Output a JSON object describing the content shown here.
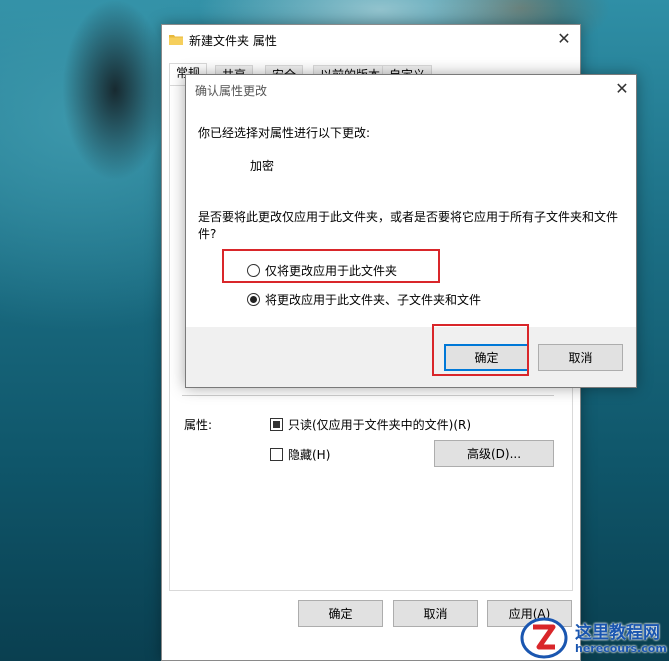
{
  "props_window": {
    "title": "新建文件夹 属性",
    "tabs": [
      {
        "label": "常规"
      },
      {
        "label": "共享"
      },
      {
        "label": "安全"
      },
      {
        "label": "以前的版本"
      },
      {
        "label": "自定义"
      }
    ],
    "attributes_label": "属性:",
    "readonly_label": "只读(仅应用于文件夹中的文件)(R)",
    "hidden_label": "隐藏(H)",
    "advanced_button": "高级(D)...",
    "ok_button": "确定",
    "cancel_button": "取消",
    "apply_button": "应用(A)"
  },
  "dialog": {
    "title": "确认属性更改",
    "intro": "你已经选择对属性进行以下更改:",
    "change": "加密",
    "question_line1": "是否要将此更改仅应用于此文件夹，或者是否要将它应用于所有子文件夹和文件",
    "question_line2": "件?",
    "option_folder_only": "仅将更改应用于此文件夹",
    "option_all": "将更改应用于此文件夹、子文件夹和文件",
    "ok_button": "确定",
    "cancel_button": "取消"
  },
  "watermark": {
    "name": "这里教程网",
    "url": "herecours.com"
  },
  "colors": {
    "highlight": "#d9262a",
    "accent": "#0078d7"
  }
}
